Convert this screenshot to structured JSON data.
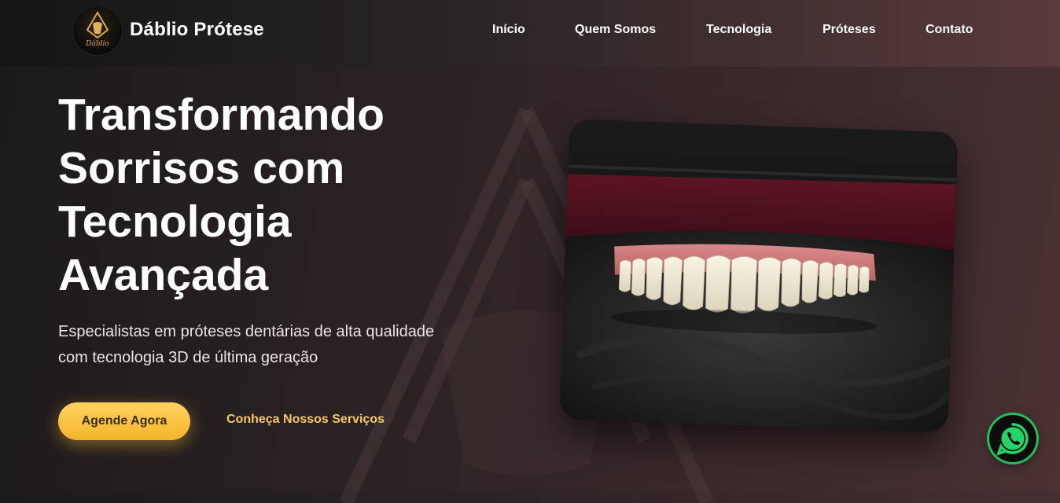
{
  "brand": {
    "name": "Dáblio Prótese",
    "logo_alt": "Dáblio PRÓTESE",
    "logo_icon": "gold-tooth-emblem-icon",
    "accent_color": "#f5b533"
  },
  "nav": {
    "items": [
      {
        "label": "Início"
      },
      {
        "label": "Quem Somos"
      },
      {
        "label": "Tecnologia"
      },
      {
        "label": "Próteses"
      },
      {
        "label": "Contato"
      }
    ]
  },
  "hero": {
    "title_lines": [
      "Transformando",
      "Sorrisos com",
      "Tecnologia",
      "Avançada"
    ],
    "subtitle_lines": [
      "Especialistas em próteses dentárias de alta qualidade",
      "com tecnologia 3D de última geração"
    ],
    "primary_button": "Agende Agora",
    "secondary_link": "Conheça Nossos Serviços",
    "image_icon": "dental-prosthesis-photo"
  },
  "floating": {
    "whatsapp_icon": "whatsapp-icon",
    "whatsapp_color": "#25d366"
  }
}
